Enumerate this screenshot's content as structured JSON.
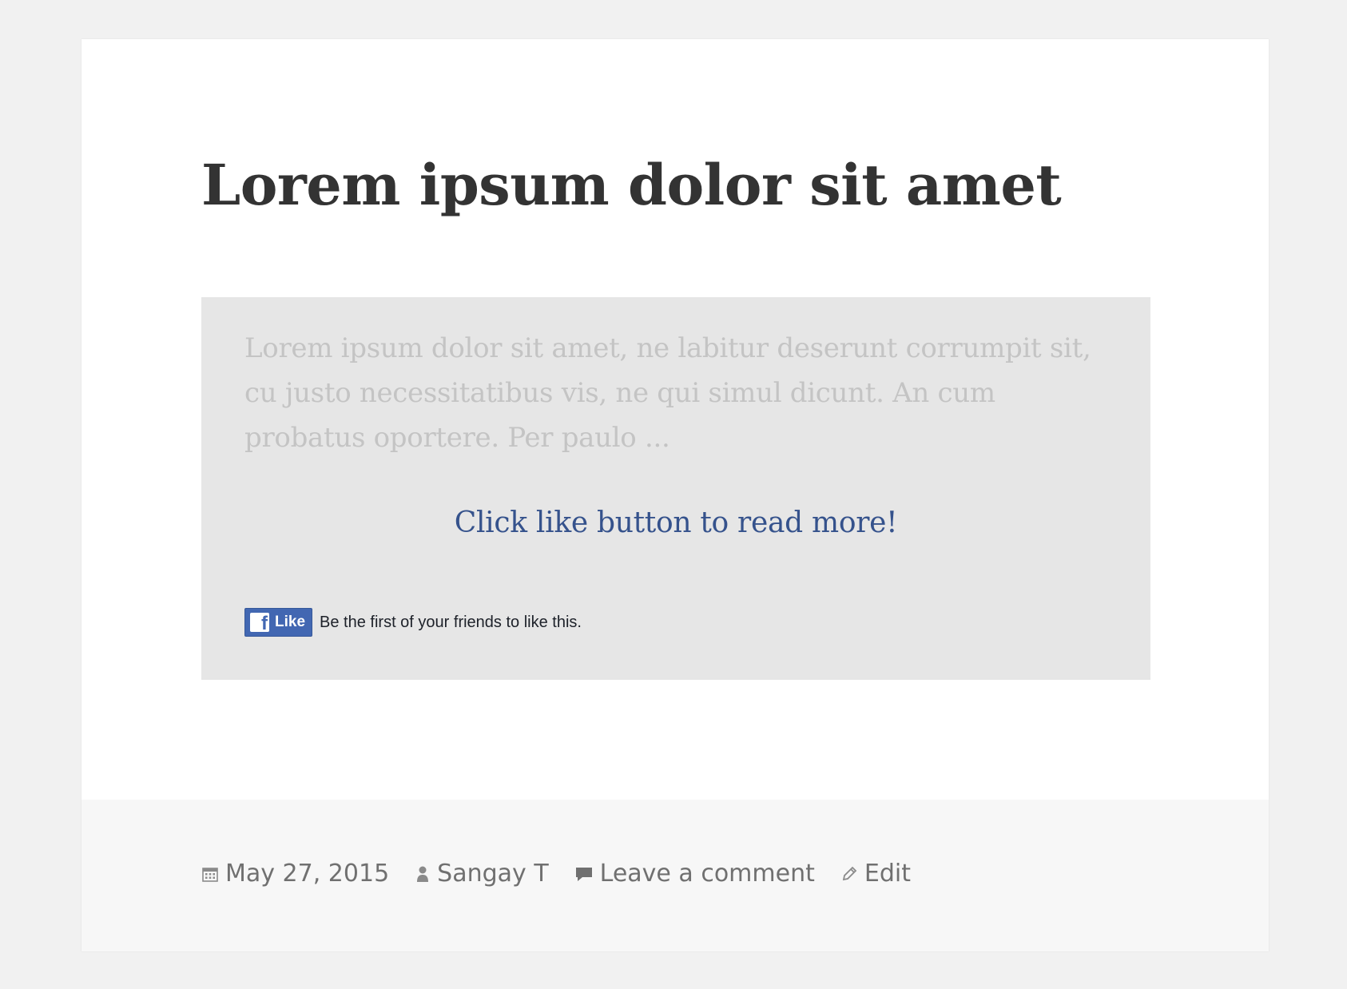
{
  "post": {
    "title": "Lorem ipsum dolor sit amet",
    "excerpt": "Lorem ipsum dolor sit amet, ne labitur deserunt corrumpit sit, cu justo necessitatibus vis, ne qui simul dicunt. An cum probatus oportere. Per paulo ...",
    "cta_text": "Click like button to read more!"
  },
  "facebook": {
    "like_label": "Like",
    "logo_letter": "f",
    "social_text": "Be the first of your friends to like this.",
    "brand_color": "#4267b2"
  },
  "footer": {
    "date": "May 27, 2015",
    "author": "Sangay T",
    "comment_link": "Leave a comment",
    "edit_link": "Edit",
    "icons": [
      "calendar-icon",
      "person-icon",
      "comment-icon",
      "pencil-icon"
    ]
  },
  "colors": {
    "page_bg": "#f1f1f1",
    "title": "#333333",
    "box_bg": "#e6e6e6",
    "excerpt": "#c4c4c4",
    "cta": "#35528c",
    "meta_text": "#707070"
  }
}
